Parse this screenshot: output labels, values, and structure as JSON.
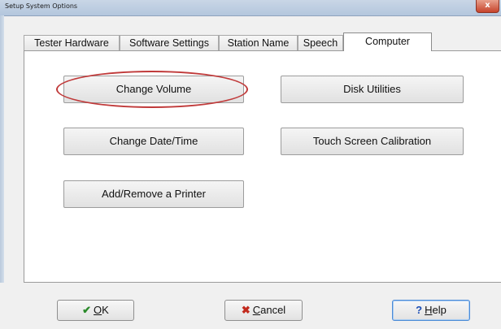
{
  "window": {
    "title": "Setup System Options",
    "close_label": "x"
  },
  "tabs": [
    {
      "label": "Tester Hardware",
      "active": false
    },
    {
      "label": "Software Settings",
      "active": false
    },
    {
      "label": "Station Name",
      "active": false
    },
    {
      "label": "Speech",
      "active": false
    },
    {
      "label": "Computer",
      "active": true
    }
  ],
  "panel": {
    "change_volume": "Change Volume",
    "disk_utilities": "Disk Utilities",
    "change_date_time": "Change Date/Time",
    "touch_screen_calibration": "Touch Screen Calibration",
    "add_remove_printer": "Add/Remove a Printer"
  },
  "footer": {
    "ok": {
      "icon": "check-icon",
      "accel": "O",
      "rest": "K",
      "color": "#2a8a2a"
    },
    "cancel": {
      "icon": "x-icon",
      "accel": "C",
      "rest": "ancel",
      "color": "#c22a1e"
    },
    "help": {
      "icon": "question-icon",
      "accel": "H",
      "rest": "elp",
      "color": "#1d4fb5"
    }
  },
  "colors": {
    "highlight_ellipse": "#c03a3a"
  }
}
